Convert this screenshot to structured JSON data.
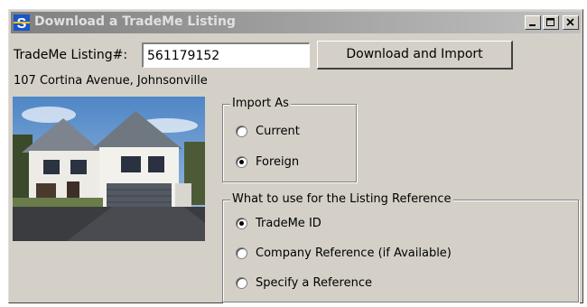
{
  "window": {
    "title": "Download a TradeMe Listing",
    "controls": [
      "minimize",
      "maximize",
      "close"
    ]
  },
  "form": {
    "listing_label": "TradeMe Listing#:",
    "listing_value": "561179152",
    "download_button": "Download and Import",
    "address": "107 Cortina Avenue, Johnsonville"
  },
  "import_as": {
    "legend": "Import As",
    "options": [
      "Current",
      "Foreign"
    ],
    "selected": "Foreign"
  },
  "listing_reference": {
    "legend": "What to use for the Listing Reference",
    "options": [
      "TradeMe ID",
      "Company Reference (if Available)",
      "Specify a Reference"
    ],
    "selected": "TradeMe ID"
  },
  "icons": {
    "app": "app-logo-icon",
    "minimize": "minimize-icon",
    "maximize": "maximize-icon",
    "close": "close-icon"
  },
  "colors": {
    "title_bar_start": "#808080",
    "title_bar_end": "#c0c0c0",
    "dialog_face": "#d4d0c8",
    "app_icon_blue": "#1a56c8"
  }
}
